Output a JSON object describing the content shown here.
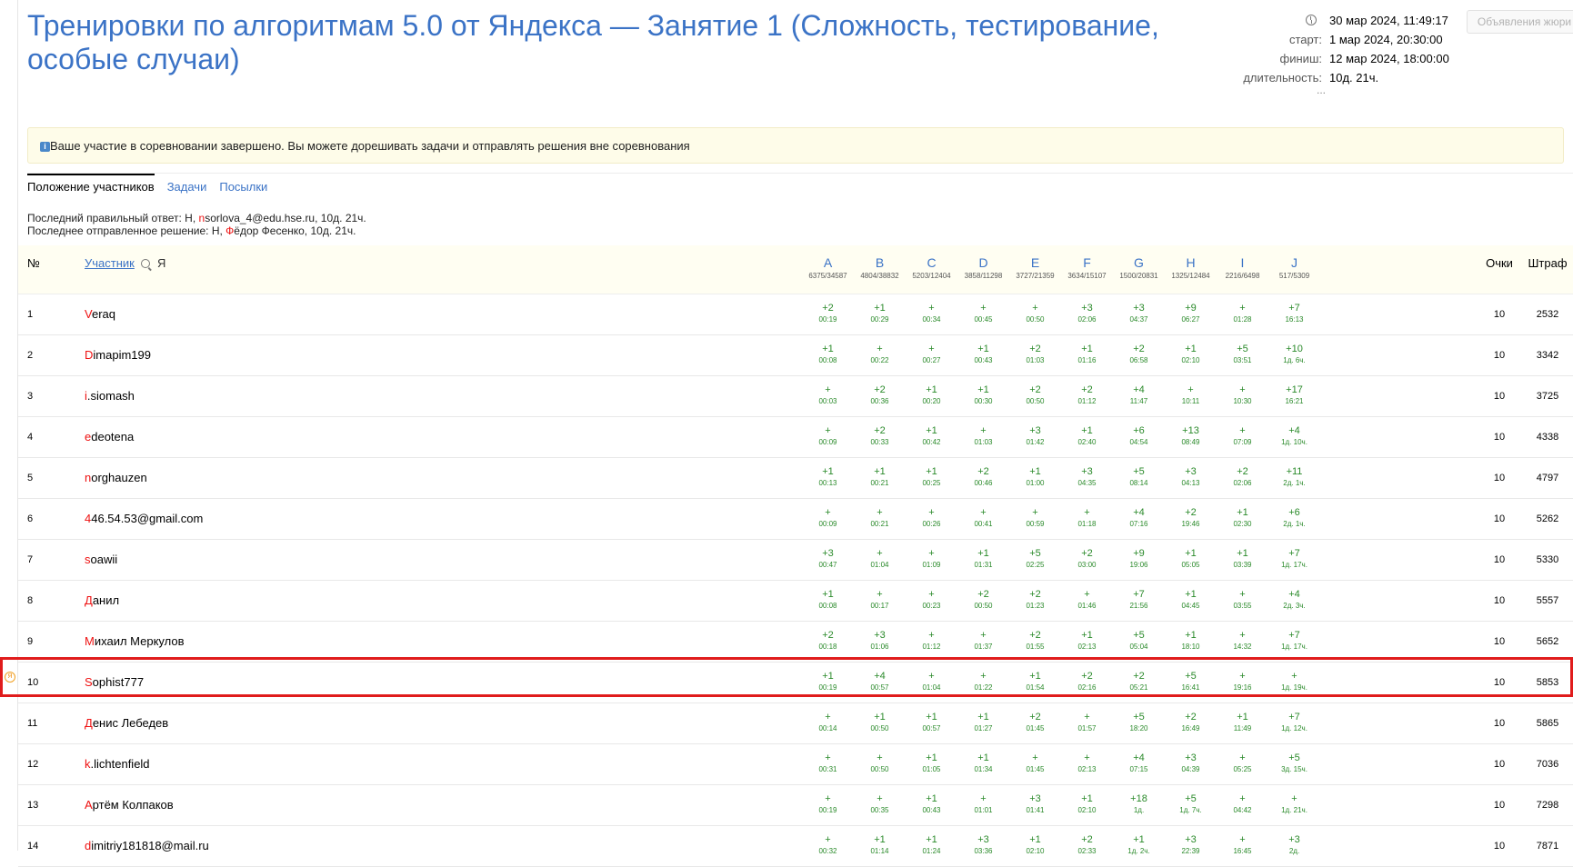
{
  "contest": {
    "title": "Тренировки по алгоритмам 5.0 от Яндекса — Занятие 1 (Сложность, тестирование, особые случаи)"
  },
  "meta": {
    "now": "30 мар 2024, 11:49:17",
    "start_label": "старт:",
    "start": "1 мар 2024, 20:30:00",
    "finish_label": "финиш:",
    "finish": "12 мар 2024, 18:00:00",
    "duration_label": "длительность:",
    "duration": "10д. 21ч.",
    "ellipsis": "..."
  },
  "jury_button": "Объявления жюри",
  "notice": "Ваше участие в соревновании завершено. Вы можете дорешивать задачи и отправлять решения вне соревнования",
  "tabs": [
    {
      "label": "Положение участников"
    },
    {
      "label": "Задачи"
    },
    {
      "label": "Посылки"
    }
  ],
  "last_correct": {
    "label": "Последний правильный ответ:",
    "problem": "H,",
    "user_first": "n",
    "user_rest": "sorlova_4@edu.hse.ru,",
    "time": "10д. 21ч."
  },
  "last_submit": {
    "label": "Последнее отправленное решение:",
    "problem": "H,",
    "user_first": "Ф",
    "user_rest": "ёдор Фесенко,",
    "time": "10д. 21ч."
  },
  "table": {
    "col_num": "№",
    "col_user": "Участник",
    "col_me": "Я",
    "col_score": "Очки",
    "col_penalty": "Штраф",
    "problems": [
      {
        "letter": "A",
        "stat": "6375/34587"
      },
      {
        "letter": "B",
        "stat": "4804/38832"
      },
      {
        "letter": "C",
        "stat": "5203/12404"
      },
      {
        "letter": "D",
        "stat": "3858/11298"
      },
      {
        "letter": "E",
        "stat": "3727/21359"
      },
      {
        "letter": "F",
        "stat": "3634/15107"
      },
      {
        "letter": "G",
        "stat": "1500/20831"
      },
      {
        "letter": "H",
        "stat": "1325/12484"
      },
      {
        "letter": "I",
        "stat": "2216/6498"
      },
      {
        "letter": "J",
        "stat": "517/5309"
      }
    ],
    "me_marker": "Я",
    "rows": [
      {
        "rank": "1",
        "first": "V",
        "rest": "eraq",
        "score": "10",
        "penalty": "2532",
        "results": [
          [
            "+2",
            "00:19"
          ],
          [
            "+1",
            "00:29"
          ],
          [
            "+",
            "00:34"
          ],
          [
            "+",
            "00:45"
          ],
          [
            "+",
            "00:50"
          ],
          [
            "+3",
            "02:06"
          ],
          [
            "+3",
            "04:37"
          ],
          [
            "+9",
            "06:27"
          ],
          [
            "+",
            "01:28"
          ],
          [
            "+7",
            "16:13"
          ]
        ]
      },
      {
        "rank": "2",
        "first": "D",
        "rest": "imapim199",
        "score": "10",
        "penalty": "3342",
        "results": [
          [
            "+1",
            "00:08"
          ],
          [
            "+",
            "00:22"
          ],
          [
            "+",
            "00:27"
          ],
          [
            "+1",
            "00:43"
          ],
          [
            "+2",
            "01:03"
          ],
          [
            "+1",
            "01:16"
          ],
          [
            "+2",
            "06:58"
          ],
          [
            "+1",
            "02:10"
          ],
          [
            "+5",
            "03:51"
          ],
          [
            "+10",
            "1д. 6ч."
          ]
        ]
      },
      {
        "rank": "3",
        "first": "i",
        "rest": ".siomash",
        "score": "10",
        "penalty": "3725",
        "results": [
          [
            "+",
            "00:03"
          ],
          [
            "+2",
            "00:36"
          ],
          [
            "+1",
            "00:20"
          ],
          [
            "+1",
            "00:30"
          ],
          [
            "+2",
            "00:50"
          ],
          [
            "+2",
            "01:12"
          ],
          [
            "+4",
            "11:47"
          ],
          [
            "+",
            "10:11"
          ],
          [
            "+",
            "10:30"
          ],
          [
            "+17",
            "16:21"
          ]
        ]
      },
      {
        "rank": "4",
        "first": "e",
        "rest": "deotena",
        "score": "10",
        "penalty": "4338",
        "results": [
          [
            "+",
            "00:09"
          ],
          [
            "+2",
            "00:33"
          ],
          [
            "+1",
            "00:42"
          ],
          [
            "+",
            "01:03"
          ],
          [
            "+3",
            "01:42"
          ],
          [
            "+1",
            "02:40"
          ],
          [
            "+6",
            "04:54"
          ],
          [
            "+13",
            "08:49"
          ],
          [
            "+",
            "07:09"
          ],
          [
            "+4",
            "1д. 10ч."
          ]
        ]
      },
      {
        "rank": "5",
        "first": "n",
        "rest": "orghauzen",
        "score": "10",
        "penalty": "4797",
        "results": [
          [
            "+1",
            "00:13"
          ],
          [
            "+1",
            "00:21"
          ],
          [
            "+1",
            "00:25"
          ],
          [
            "+2",
            "00:46"
          ],
          [
            "+1",
            "01:00"
          ],
          [
            "+3",
            "04:35"
          ],
          [
            "+5",
            "08:14"
          ],
          [
            "+3",
            "04:13"
          ],
          [
            "+2",
            "02:06"
          ],
          [
            "+11",
            "2д. 1ч."
          ]
        ]
      },
      {
        "rank": "6",
        "first": "4",
        "rest": "46.54.53@gmail.com",
        "score": "10",
        "penalty": "5262",
        "results": [
          [
            "+",
            "00:09"
          ],
          [
            "+",
            "00:21"
          ],
          [
            "+",
            "00:26"
          ],
          [
            "+",
            "00:41"
          ],
          [
            "+",
            "00:59"
          ],
          [
            "+",
            "01:18"
          ],
          [
            "+4",
            "07:16"
          ],
          [
            "+2",
            "19:46"
          ],
          [
            "+1",
            "02:30"
          ],
          [
            "+6",
            "2д. 1ч."
          ]
        ]
      },
      {
        "rank": "7",
        "first": "s",
        "rest": "oawii",
        "score": "10",
        "penalty": "5330",
        "results": [
          [
            "+3",
            "00:47"
          ],
          [
            "+",
            "01:04"
          ],
          [
            "+",
            "01:09"
          ],
          [
            "+1",
            "01:31"
          ],
          [
            "+5",
            "02:25"
          ],
          [
            "+2",
            "03:00"
          ],
          [
            "+9",
            "19:06"
          ],
          [
            "+1",
            "05:05"
          ],
          [
            "+1",
            "03:39"
          ],
          [
            "+7",
            "1д. 17ч."
          ]
        ]
      },
      {
        "rank": "8",
        "first": "Д",
        "rest": "анил",
        "score": "10",
        "penalty": "5557",
        "results": [
          [
            "+1",
            "00:08"
          ],
          [
            "+",
            "00:17"
          ],
          [
            "+",
            "00:23"
          ],
          [
            "+2",
            "00:50"
          ],
          [
            "+2",
            "01:23"
          ],
          [
            "+",
            "01:46"
          ],
          [
            "+7",
            "21:56"
          ],
          [
            "+1",
            "04:45"
          ],
          [
            "+",
            "03:55"
          ],
          [
            "+4",
            "2д. 3ч."
          ]
        ]
      },
      {
        "rank": "9",
        "first": "М",
        "rest": "ихаил Меркулов",
        "score": "10",
        "penalty": "5652",
        "results": [
          [
            "+2",
            "00:18"
          ],
          [
            "+3",
            "01:06"
          ],
          [
            "+",
            "01:12"
          ],
          [
            "+",
            "01:37"
          ],
          [
            "+2",
            "01:55"
          ],
          [
            "+1",
            "02:13"
          ],
          [
            "+5",
            "05:04"
          ],
          [
            "+1",
            "18:10"
          ],
          [
            "+",
            "14:32"
          ],
          [
            "+7",
            "1д. 17ч."
          ]
        ]
      },
      {
        "rank": "10",
        "first": "S",
        "rest": "ophist777",
        "score": "10",
        "penalty": "5853",
        "me": true,
        "results": [
          [
            "+1",
            "00:19"
          ],
          [
            "+4",
            "00:57"
          ],
          [
            "+",
            "01:04"
          ],
          [
            "+",
            "01:22"
          ],
          [
            "+1",
            "01:54"
          ],
          [
            "+2",
            "02:16"
          ],
          [
            "+2",
            "05:21"
          ],
          [
            "+5",
            "16:41"
          ],
          [
            "+",
            "19:16"
          ],
          [
            "+",
            "1д. 19ч."
          ]
        ]
      },
      {
        "rank": "11",
        "first": "Д",
        "rest": "енис Лебедев",
        "score": "10",
        "penalty": "5865",
        "results": [
          [
            "+",
            "00:14"
          ],
          [
            "+1",
            "00:50"
          ],
          [
            "+1",
            "00:57"
          ],
          [
            "+1",
            "01:27"
          ],
          [
            "+2",
            "01:45"
          ],
          [
            "+",
            "01:57"
          ],
          [
            "+5",
            "18:20"
          ],
          [
            "+2",
            "16:49"
          ],
          [
            "+1",
            "11:49"
          ],
          [
            "+7",
            "1д. 12ч."
          ]
        ]
      },
      {
        "rank": "12",
        "first": "k",
        "rest": ".lichtenfield",
        "score": "10",
        "penalty": "7036",
        "results": [
          [
            "+",
            "00:31"
          ],
          [
            "+",
            "00:50"
          ],
          [
            "+1",
            "01:05"
          ],
          [
            "+1",
            "01:34"
          ],
          [
            "+",
            "01:45"
          ],
          [
            "+",
            "02:13"
          ],
          [
            "+4",
            "07:15"
          ],
          [
            "+3",
            "04:39"
          ],
          [
            "+",
            "05:25"
          ],
          [
            "+5",
            "3д. 15ч."
          ]
        ]
      },
      {
        "rank": "13",
        "first": "А",
        "rest": "ртём Колпаков",
        "score": "10",
        "penalty": "7298",
        "results": [
          [
            "+",
            "00:19"
          ],
          [
            "+",
            "00:35"
          ],
          [
            "+1",
            "00:43"
          ],
          [
            "+",
            "01:01"
          ],
          [
            "+3",
            "01:41"
          ],
          [
            "+1",
            "02:10"
          ],
          [
            "+18",
            "1д."
          ],
          [
            "+5",
            "1д. 7ч."
          ],
          [
            "+",
            "04:42"
          ],
          [
            "+",
            "1д. 21ч."
          ]
        ]
      },
      {
        "rank": "14",
        "first": "d",
        "rest": "imitriy181818@mail.ru",
        "score": "10",
        "penalty": "7871",
        "results": [
          [
            "+",
            "00:32"
          ],
          [
            "+1",
            "01:14"
          ],
          [
            "+1",
            "01:24"
          ],
          [
            "+3",
            "03:36"
          ],
          [
            "+1",
            "02:10"
          ],
          [
            "+2",
            "02:33"
          ],
          [
            "+1",
            "1д. 2ч."
          ],
          [
            "+3",
            "22:39"
          ],
          [
            "+",
            "16:45"
          ],
          [
            "+3",
            "2д."
          ]
        ]
      }
    ]
  }
}
